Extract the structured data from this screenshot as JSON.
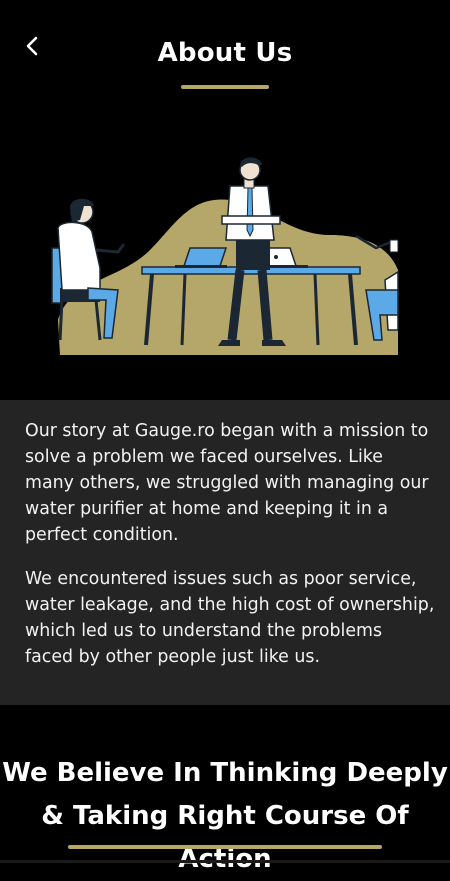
{
  "header": {
    "title": "About Us",
    "back_icon": "chevron-left-icon"
  },
  "colors": {
    "accent": "#b5a66a",
    "background": "#000000",
    "panel": "#242424",
    "illustration_blue": "#5ba9e6"
  },
  "story": {
    "paragraphs": [
      "Our story at Gauge.ro began with a mission to solve a problem we faced ourselves. Like many others, we struggled with managing our water purifier at home and keeping it in a perfect condition.",
      "We encountered issues such as poor service, water leakage, and the high cost of ownership, which led us to understand the problems faced by other people just like us."
    ]
  },
  "believe": {
    "line1": "We Believe In Thinking Deeply",
    "line2": "& Taking Right Course Of Action"
  }
}
